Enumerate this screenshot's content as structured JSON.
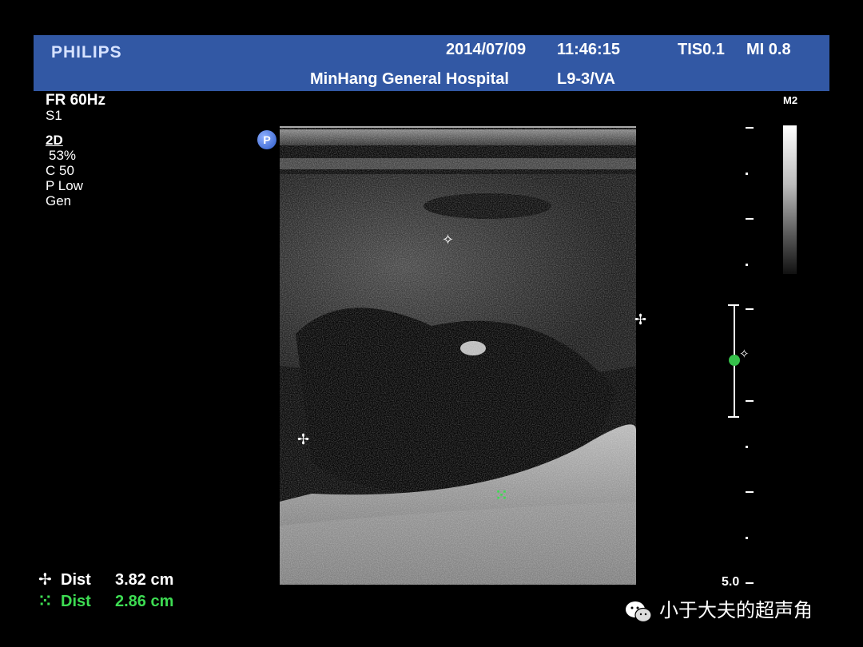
{
  "header": {
    "brand": "PHILIPS",
    "date": "2014/07/09",
    "time": "11:46:15",
    "tis": "TIS0.1",
    "mi": "MI 0.8",
    "hospital": "MinHang General Hospital",
    "probe": "L9-3/VA"
  },
  "params": {
    "frame_rate": "FR 60Hz",
    "s": "S1",
    "mode": "2D",
    "gain": "53%",
    "compression": "C 50",
    "power": "P Low",
    "preset": "Gen"
  },
  "badge": "P",
  "grayscale_label": "M2",
  "depth_end": "5.0",
  "markers": {
    "white": "✧",
    "green": "⁙"
  },
  "measurements": [
    {
      "symbol": "✢",
      "label": "Dist",
      "value": "3.82 cm",
      "color": "#ffffff"
    },
    {
      "symbol": "⁙",
      "label": "Dist",
      "value": "2.86 cm",
      "color": "#3ddc52"
    }
  ],
  "watermark": "小于大夫的超声角"
}
